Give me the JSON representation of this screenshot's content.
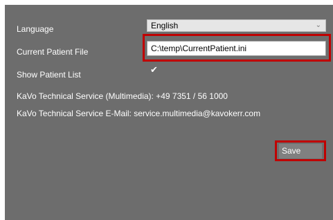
{
  "settings": {
    "language_label": "Language",
    "language_value": "English",
    "patient_file_label": "Current Patient File",
    "patient_file_value": "C:\\temp\\CurrentPatient.ini",
    "show_patient_list_label": "Show Patient List",
    "show_patient_list_checked": true,
    "checkbox_glyph": "✔",
    "service_phone_text": "KaVo Technical Service (Multimedia): +49 7351 / 56 1000",
    "service_email_text": "KaVo Technical Service E-Mail: service.multimedia@kavokerr.com",
    "save_label": "Save"
  },
  "icons": {
    "dropdown": "chevron-down-icon"
  },
  "colors": {
    "panel_background": "#6d6d6d",
    "highlight_border": "#c00000",
    "save_button": "#808080"
  }
}
